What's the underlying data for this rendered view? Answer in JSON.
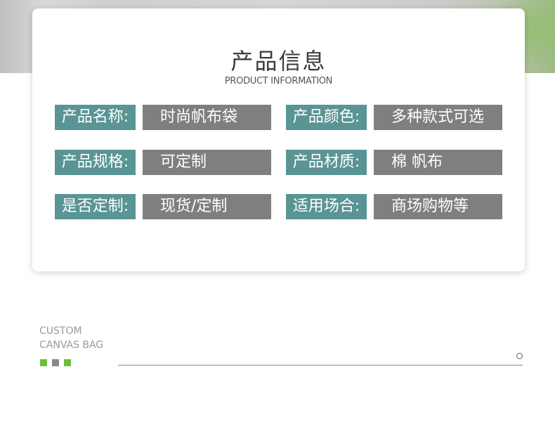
{
  "header": {
    "title": "产品信息",
    "subtitle": "PRODUCT INFORMATION"
  },
  "rows": [
    {
      "left_label": "产品名称:",
      "left_value": "时尚帆布袋",
      "right_label": "产品颜色:",
      "right_value": "多种款式可选"
    },
    {
      "left_label": "产品规格:",
      "left_value": "可定制",
      "right_label": "产品材质:",
      "right_value": "棉 帆布"
    },
    {
      "left_label": "是否定制:",
      "left_value": "现货/定制",
      "right_label": "适用场合:",
      "right_value": "商场购物等"
    }
  ],
  "footer": {
    "line1": "CUSTOM",
    "line2": "CANVAS BAG",
    "square_colors": [
      "#6bbf3a",
      "#888888",
      "#6bbf3a"
    ]
  },
  "colors": {
    "label_bg": "#5a9494",
    "value_bg": "#7f7f7f"
  }
}
